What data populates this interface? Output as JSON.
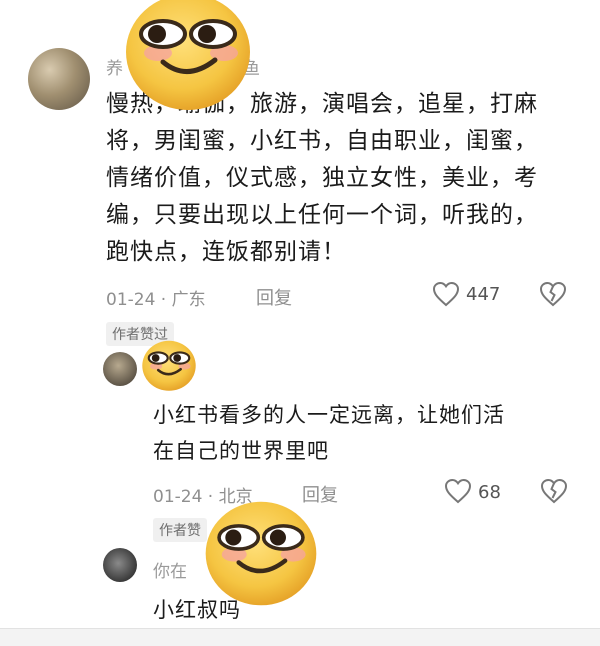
{
  "comment": {
    "username": "养",
    "username_tail": "鱼",
    "lines": [
      "慢热，瑜伽，旅游，演唱会，追星，打麻",
      "将，男闺蜜，小红书，自由职业，闺蜜，",
      "情绪价值，仪式感，独立女性，美业，考",
      "编，只要出现以上任何一个词，听我的，",
      "跑快点，连饭都别请！"
    ],
    "date_location": "01-24 · 广东",
    "reply_label": "回复",
    "likes": "447",
    "author_badge": "作者赞过"
  },
  "reply1": {
    "lines": [
      "小红书看多的人一定远离，让她们活",
      "在自己的世界里吧"
    ],
    "date_location": "01-24 · 北京",
    "reply_label": "回复",
    "likes": "68",
    "author_badge": "作者赞"
  },
  "reply2": {
    "username": "你在",
    "text": "小红叔吗"
  },
  "icons": {
    "like": "heart-outline-icon",
    "dislike": "broken-heart-icon",
    "sticker": "smirk-emoji-sticker"
  },
  "colors": {
    "emoji_face": "#f5c542",
    "emoji_edge": "#e7a52a",
    "meta_gray": "#8f8f8f"
  }
}
